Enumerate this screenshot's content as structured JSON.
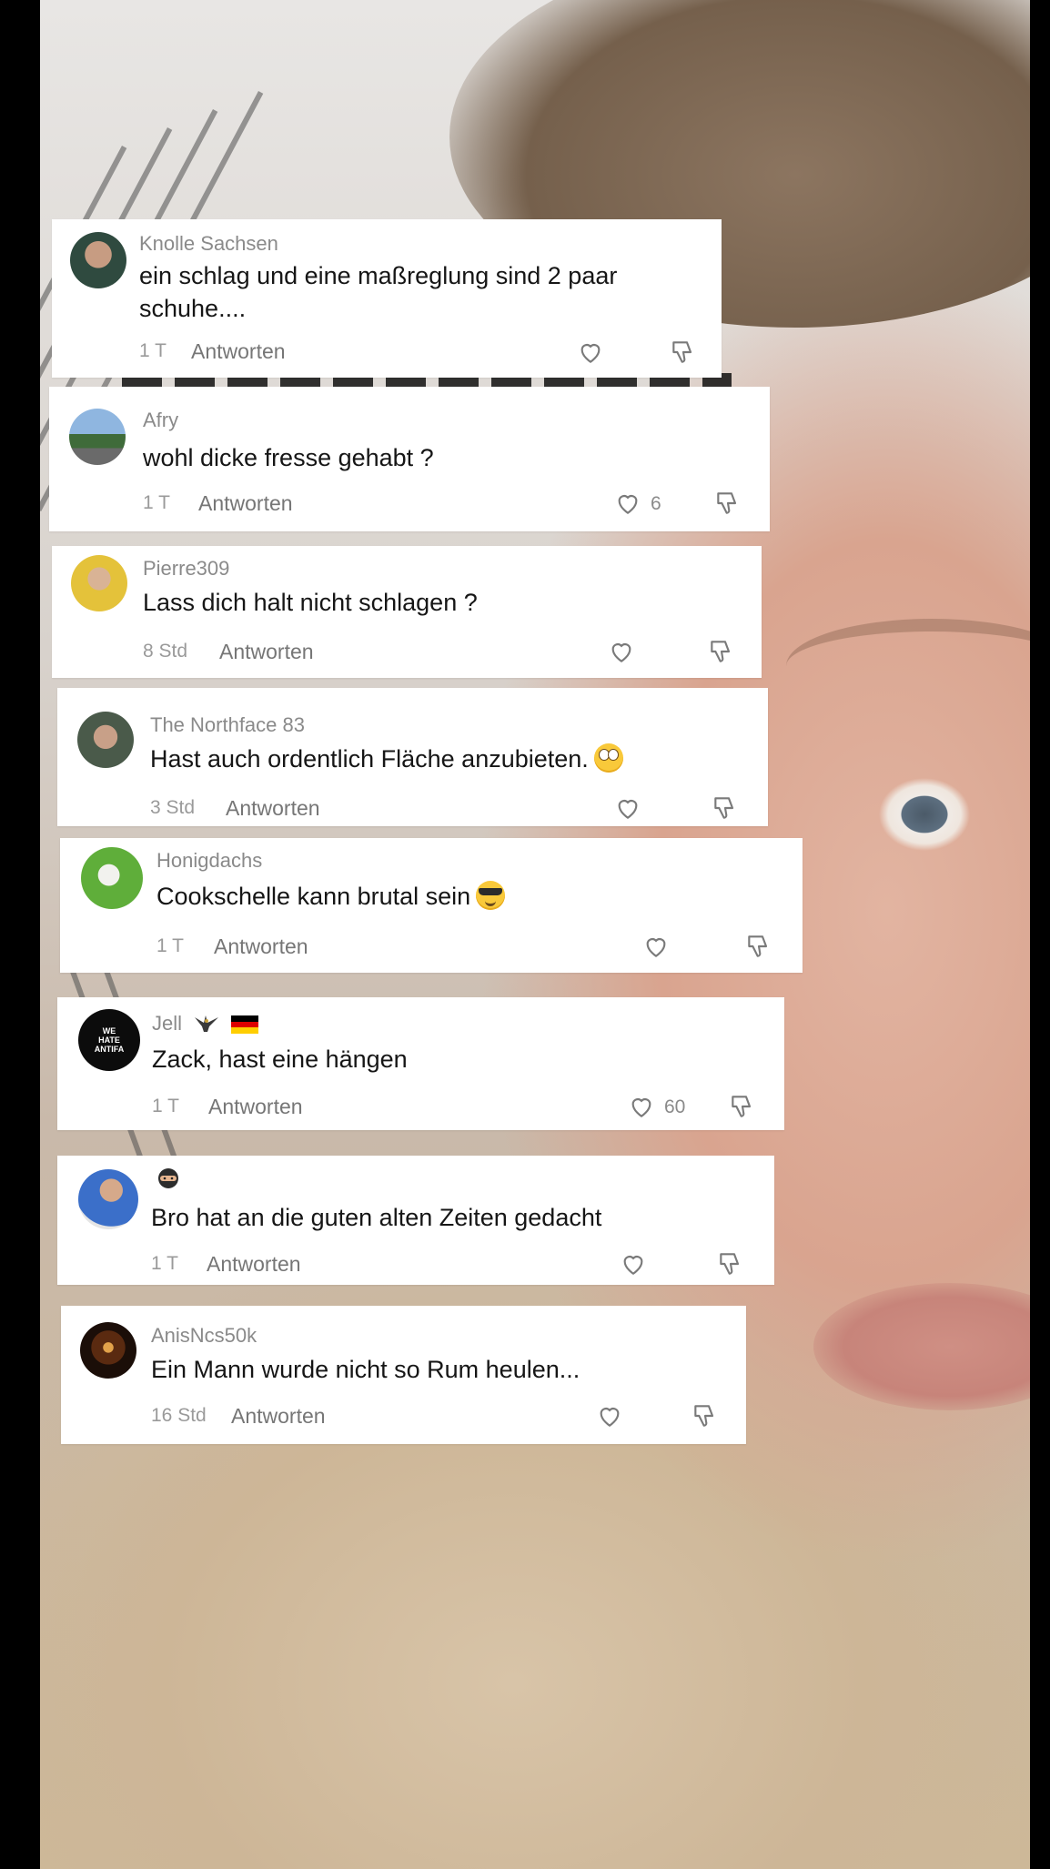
{
  "comments": [
    {
      "user": "Knolle Sachsen",
      "text": "ein schlag und eine maßreglung sind 2 paar schuhe....",
      "time": "1 T",
      "reply": "Antworten",
      "likes": ""
    },
    {
      "user": "Afry",
      "text": "wohl dicke fresse gehabt ?",
      "time": "1 T",
      "reply": "Antworten",
      "likes": "6"
    },
    {
      "user": "Pierre309",
      "text": "Lass dich halt nicht schlagen ?",
      "time": "8 Std",
      "reply": "Antworten",
      "likes": ""
    },
    {
      "user": "The Northface 83",
      "text": "Hast auch ordentlich Fläche anzubieten.",
      "emoji": "face-with-rolling-eyes",
      "time": "3 Std",
      "reply": "Antworten",
      "likes": ""
    },
    {
      "user": "Honigdachs",
      "text": "Cookschelle kann brutal sein",
      "emoji": "smiling-face-with-sunglasses",
      "time": "1 T",
      "reply": "Antworten",
      "likes": ""
    },
    {
      "user": "Jell",
      "user_flair": [
        "eagle-icon",
        "german-flag-icon"
      ],
      "avatar_text": "WE HATE ANTIFA",
      "text": "Zack, hast eine hängen",
      "time": "1 T",
      "reply": "Antworten",
      "likes": "60"
    },
    {
      "user": "",
      "user_flair": [
        "ninja-emoji-icon"
      ],
      "text": "Bro hat an die guten alten Zeiten gedacht",
      "time": "1 T",
      "reply": "Antworten",
      "likes": ""
    },
    {
      "user": "AnisNcs50k",
      "text": "Ein Mann wurde nicht so Rum heulen...",
      "time": "16 Std",
      "reply": "Antworten",
      "likes": ""
    }
  ],
  "colors": {
    "card_bg": "#ffffff",
    "text": "#161616",
    "muted": "#8a8a8a",
    "heart_outline": "#7a7a7a"
  }
}
